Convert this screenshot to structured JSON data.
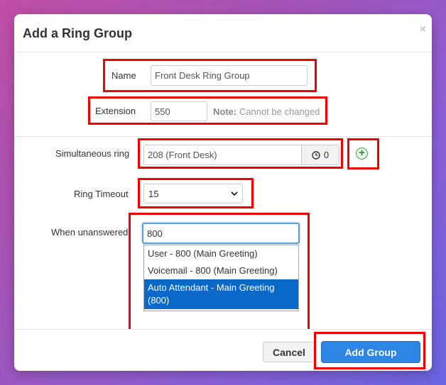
{
  "dialog": {
    "title": "Add a Ring Group",
    "close_glyph": "×"
  },
  "form": {
    "name": {
      "label": "Name",
      "value": "Front Desk Ring Group"
    },
    "extension": {
      "label": "Extension",
      "value": "550",
      "note_bold": "Note:",
      "note_text": "Cannot be changed"
    },
    "simultaneous_ring": {
      "label": "Simultaneous ring",
      "value": "208 (Front Desk)",
      "timer_value": "0",
      "timer_icon": "clock-icon",
      "add_icon": "plus-circle-icon"
    },
    "ring_timeout": {
      "label": "Ring Timeout",
      "selected": "15"
    },
    "when_unanswered": {
      "label": "When unanswered",
      "value": "800",
      "options": [
        "User - 800 (Main Greeting)",
        "Voicemail - 800 (Main Greeting)",
        "Auto Attendant - Main Greeting (800)"
      ],
      "selected_index": 2
    }
  },
  "footer": {
    "cancel_label": "Cancel",
    "add_label": "Add Group"
  },
  "colors": {
    "accent": "#2d86e4",
    "highlight": "#e00000",
    "selected_option": "#0a68c9"
  }
}
